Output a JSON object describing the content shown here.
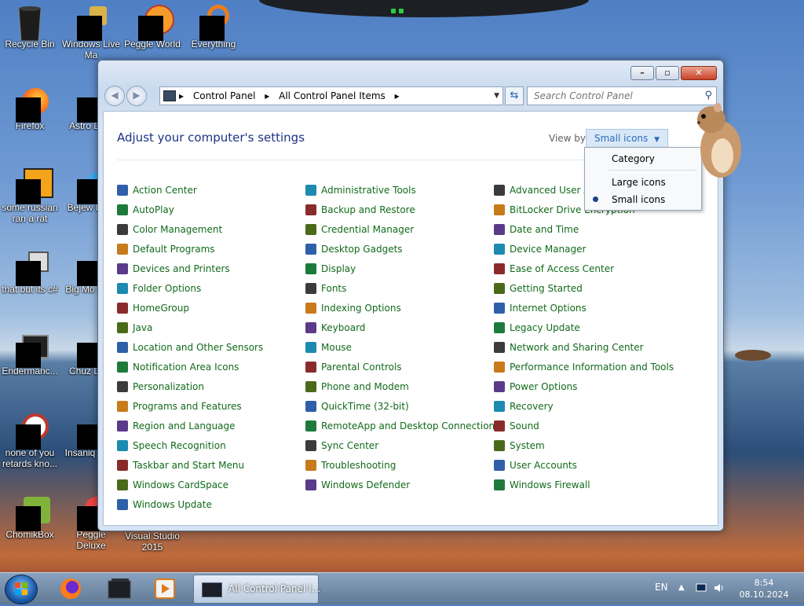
{
  "desktop": {
    "icons": [
      {
        "label": "Recycle Bin"
      },
      {
        "label": "Windows Live Ma"
      },
      {
        "label": "Peggle World"
      },
      {
        "label": "Everything"
      },
      {
        "label": "Firefox"
      },
      {
        "label": "Astro Delu"
      },
      {
        "label": "some russian ran a rat"
      },
      {
        "label": "Bejew Delu"
      },
      {
        "label": "that but its c#"
      },
      {
        "label": "Big Mo Delu"
      },
      {
        "label": "Endermanc..."
      },
      {
        "label": "Chuz Delu"
      },
      {
        "label": "none of you retards kno..."
      },
      {
        "label": "Insaniq Delu"
      },
      {
        "label": "ChomikBox"
      },
      {
        "label": "Peggle Deluxe"
      },
      {
        "label": "Visual Studio 2015"
      }
    ]
  },
  "window": {
    "address": {
      "crumbs": [
        "Control Panel",
        "All Control Panel Items"
      ]
    },
    "search": {
      "placeholder": "Search Control Panel"
    },
    "heading": "Adjust your computer's settings",
    "view_by_label": "View by:",
    "view_by_value": "Small icons",
    "view_menu": {
      "items": [
        "Category",
        "Large icons",
        "Small icons"
      ],
      "selected": "Small icons"
    },
    "columns": [
      [
        "Action Center",
        "AutoPlay",
        "Color Management",
        "Default Programs",
        "Devices and Printers",
        "Folder Options",
        "HomeGroup",
        "Java",
        "Location and Other Sensors",
        "Notification Area Icons",
        "Personalization",
        "Programs and Features",
        "Region and Language",
        "Speech Recognition",
        "Taskbar and Start Menu",
        "Windows CardSpace",
        "Windows Update"
      ],
      [
        "Administrative Tools",
        "Backup and Restore",
        "Credential Manager",
        "Desktop Gadgets",
        "Display",
        "Fonts",
        "Indexing Options",
        "Keyboard",
        "Mouse",
        "Parental Controls",
        "Phone and Modem",
        "QuickTime (32-bit)",
        "RemoteApp and Desktop Connections",
        "Sync Center",
        "Troubleshooting",
        "Windows Defender"
      ],
      [
        "Advanced User Ac",
        "BitLocker Drive Encryption",
        "Date and Time",
        "Device Manager",
        "Ease of Access Center",
        "Getting Started",
        "Internet Options",
        "Legacy Update",
        "Network and Sharing Center",
        "Performance Information and Tools",
        "Power Options",
        "Recovery",
        "Sound",
        "System",
        "User Accounts",
        "Windows Firewall"
      ]
    ]
  },
  "taskbar": {
    "active_task": "All Control Panel I...",
    "language": "EN",
    "time": "8:54",
    "date": "08.10.2024"
  },
  "colors": {
    "link_green": "#116a1b",
    "heading_blue": "#1e3287",
    "accent_blue": "#2b6dc0"
  }
}
